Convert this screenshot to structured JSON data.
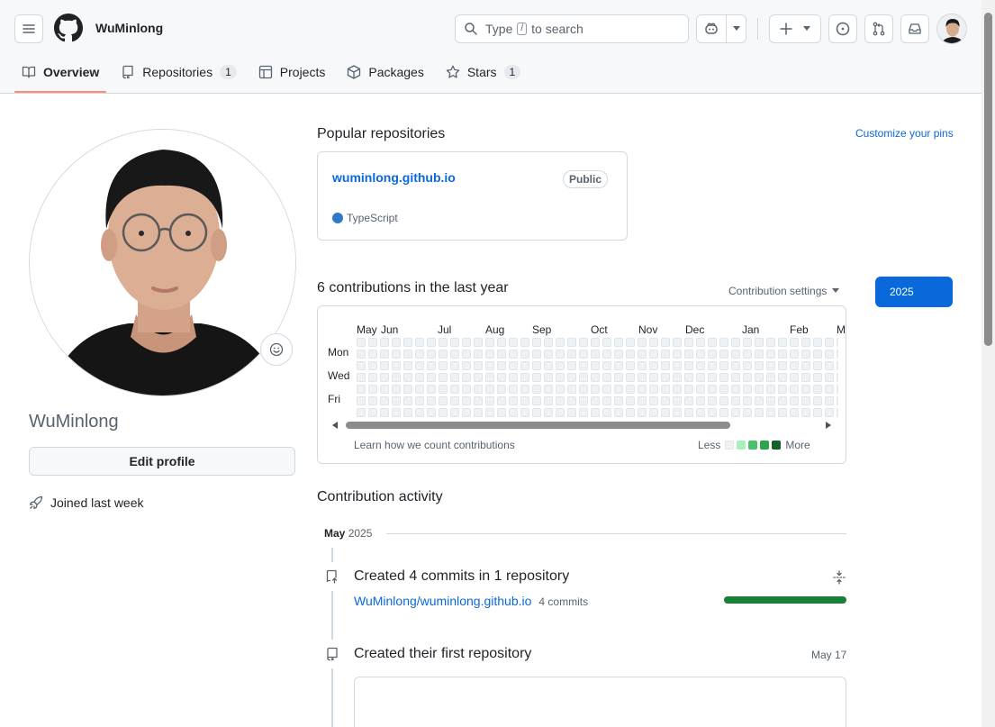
{
  "header": {
    "username": "WuMinlong",
    "search": {
      "prefix": "Type",
      "key": "/",
      "suffix": "to search"
    }
  },
  "tabs": [
    {
      "label": "Overview",
      "count": null,
      "icon": "book-icon"
    },
    {
      "label": "Repositories",
      "count": "1",
      "icon": "repo-icon"
    },
    {
      "label": "Projects",
      "count": null,
      "icon": "table-icon"
    },
    {
      "label": "Packages",
      "count": null,
      "icon": "package-icon"
    },
    {
      "label": "Stars",
      "count": "1",
      "icon": "star-icon"
    }
  ],
  "profile": {
    "name": "WuMinlong",
    "edit_label": "Edit profile",
    "joined": "Joined last week"
  },
  "pinned": {
    "heading": "Popular repositories",
    "customize": "Customize your pins",
    "repo": {
      "name": "wuminlong.github.io",
      "visibility": "Public",
      "language": "TypeScript",
      "language_color": "#3178c6"
    }
  },
  "contributions": {
    "title": "6 contributions in the last year",
    "settings": "Contribution settings",
    "year": "2025",
    "months": [
      "May",
      "Jun",
      "Jul",
      "Aug",
      "Sep",
      "Oct",
      "Nov",
      "Dec",
      "Jan",
      "Feb",
      "M"
    ],
    "days": [
      "Mon",
      "Wed",
      "Fri"
    ],
    "learn": "Learn how we count contributions",
    "legend_less": "Less",
    "legend_more": "More",
    "legend_colors": [
      "#eff2f5",
      "#aceebb",
      "#4ac26b",
      "#2da44e",
      "#116329"
    ]
  },
  "activity": {
    "heading": "Contribution activity",
    "month": "May",
    "year": "2025",
    "event1": {
      "title": "Created 4 commits in 1 repository",
      "repo": "WuMinlong/wuminlong.github.io",
      "count": "4 commits",
      "progress": 1.0
    },
    "event2": {
      "title": "Created their first repository",
      "date": "May 17"
    }
  }
}
